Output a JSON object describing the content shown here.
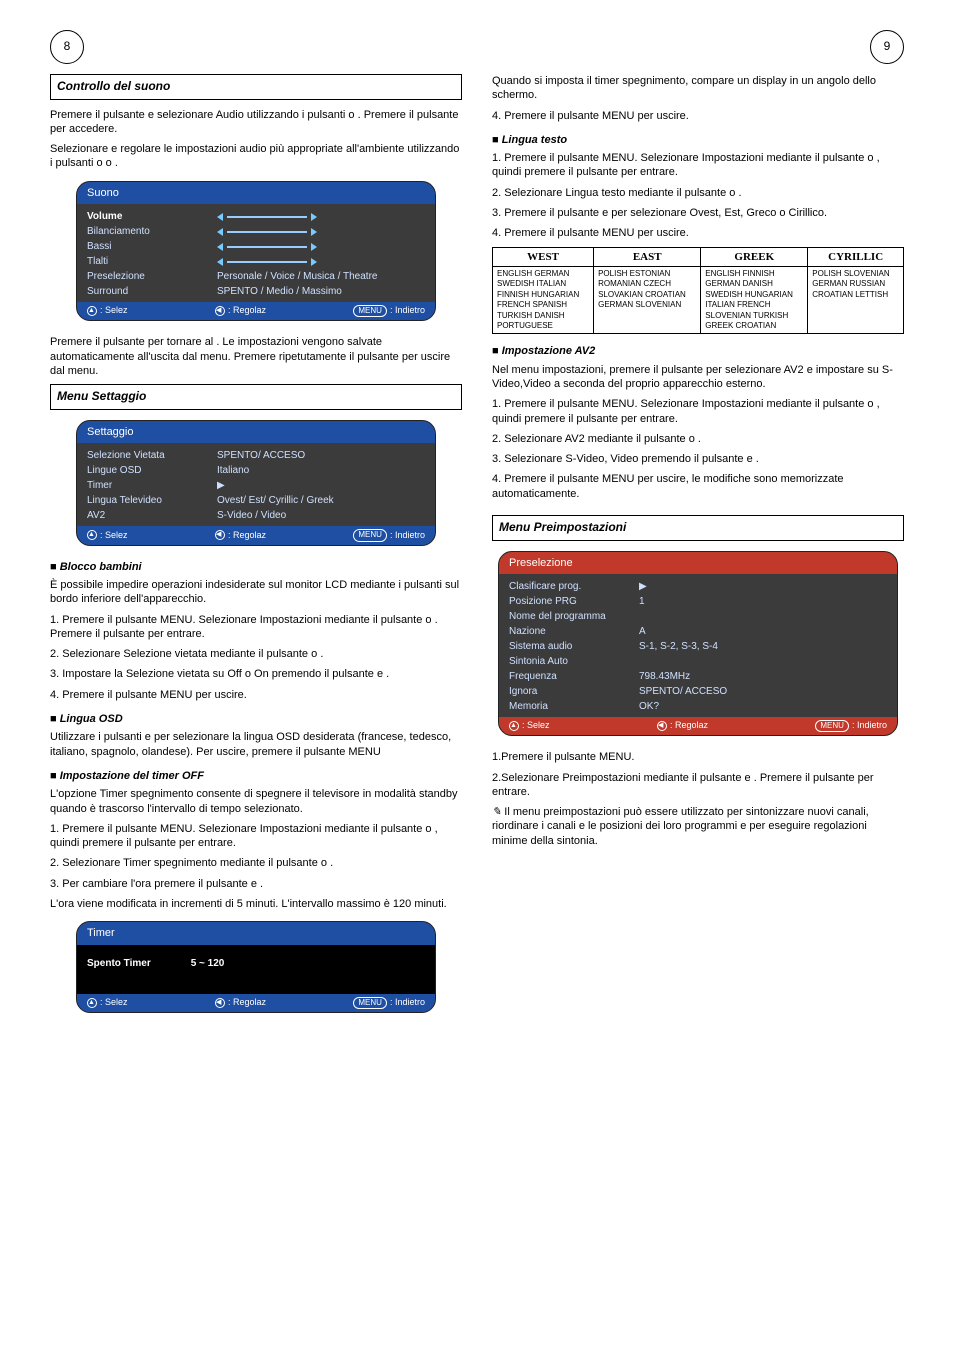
{
  "page": {
    "left_no": "8",
    "right_no": "9"
  },
  "leftcol": {
    "section1_title": "Controllo del suono",
    "p1a": "Premere il pulsante ",
    "p1b": " e selezionare Audio utilizzando i pulsanti ",
    "p1c": " o ",
    "p1d": ". Premere il pulsante ",
    "p1e": " per accedere.",
    "p2": "Selezionare e regolare le impostazioni audio più appropriate all'ambiente utilizzando i pulsanti ",
    "p2b": " o ",
    "p2c": " o ",
    "p2d": ".",
    "osd1": {
      "title": "Suono",
      "rows": [
        {
          "label": "Volume",
          "slider": true
        },
        {
          "label": "Bilanciamento",
          "slider": true
        },
        {
          "label": "Bassi",
          "slider": true
        },
        {
          "label": "Tlalti",
          "slider": true
        },
        {
          "label": "Preselezione",
          "value": "Personale / Voice / Musica / Theatre"
        },
        {
          "label": "Surround",
          "value": "SPENTO / Medio / Massimo"
        }
      ],
      "footer": {
        "sel": ": Selez",
        "reg": ": Regolaz",
        "back": ": Indietro",
        "menu": "MENU"
      }
    },
    "p3a": "Premere il pulsante ",
    "p3b": " per tornare al ",
    "p3c": ". Le impostazioni vengono salvate automaticamente all'uscita dal menu. Premere ripetutamente il pulsante ",
    "p3d": " per uscire dal menu.",
    "section2_title": "Menu Settaggio",
    "osd2": {
      "title": "Settaggio",
      "rows": [
        {
          "label": "Selezione Vietata",
          "value": "SPENTO/ ACCESO"
        },
        {
          "label": "Lingue OSD",
          "value": "Italiano"
        },
        {
          "label": "Timer",
          "value": "▶"
        },
        {
          "label": "Lingua Televideo",
          "value": "Ovest/ Est/ Cyrillic / Greek"
        },
        {
          "label": "AV2",
          "value": "S-Video / Video"
        }
      ],
      "footer": {
        "sel": ": Selez",
        "reg": ": Regolaz",
        "back": ": Indietro",
        "menu": "MENU"
      }
    },
    "h_childlock": "Blocco bambini",
    "cl_p1": "È possibile impedire operazioni indesiderate sul monitor LCD mediante i pulsanti sul bordo inferiore dell'apparecchio.",
    "cl_p2a": "1. Premere il pulsante MENU. Selezionare Impostazioni mediante il pulsante ",
    "cl_p2b": " o ",
    "cl_p2c": ". Premere il pulsante ",
    "cl_p2d": " per entrare.",
    "cl_p3a": "2. Selezionare Selezione vietata mediante il pulsante ",
    "cl_p3b": " o ",
    "cl_p3c": ".",
    "cl_p4a": "3. Impostare la Selezione vietata su Off o On premendo il pulsante ",
    "cl_p4b": " e ",
    "cl_p4c": ".",
    "cl_p5": "4. Premere il pulsante MENU per uscire.",
    "h_osdlang": "Lingua OSD",
    "osdl_p1a": "Utilizzare i pulsanti ",
    "osdl_p1b": " e ",
    "osdl_p1c": " per selezionare la lingua OSD desiderata (francese, tedesco, italiano, spagnolo, olandese). Per uscire, premere il pulsante MENU",
    "h_sleep": "Impostazione del timer OFF",
    "sl_p1": "L'opzione Timer spegnimento consente di spegnere il televisore in modalità standby quando è trascorso l'intervallo di tempo selezionato.",
    "sl_p2a": "1. Premere il pulsante MENU. Selezionare Impostazioni mediante il pulsante ",
    "sl_p2b": " o ",
    "sl_p2c": ", quindi premere il pulsante ",
    "sl_p2d": " per entrare.",
    "sl_p3a": "2. Selezionare Timer spegnimento mediante il pulsante ",
    "sl_p3b": " o ",
    "sl_p3c": ".",
    "sl_p4a": "3. Per cambiare l'ora premere il pulsante ",
    "sl_p4b": " e ",
    "sl_p4c": ".",
    "sl_p5": "L'ora viene modificata in incrementi di 5 minuti. L'intervallo massimo è 120 minuti.",
    "osd3": {
      "title": "Timer",
      "row_label": "Spento Timer",
      "row_value": "5 ~ 120",
      "footer": {
        "sel": ": Selez",
        "reg": ": Regolaz",
        "back": ": Indietro",
        "menu": "MENU"
      }
    }
  },
  "rightcol": {
    "top_p1": "Quando si imposta il timer spegnimento, compare un display in un angolo dello schermo.",
    "top_p2": "4. Premere il pulsante MENU per uscire.",
    "h_txtlang": "Lingua testo",
    "tx_p1a": "1. Premere il pulsante MENU. Selezionare Impostazioni mediante il pulsante ",
    "tx_p1b": " o ",
    "tx_p1c": ", quindi premere il pulsante ",
    "tx_p1d": " per entrare.",
    "tx_p2a": "2. Selezionare Lingua testo mediante il pulsante ",
    "tx_p2b": " o ",
    "tx_p2c": ".",
    "tx_p3a": "3. Premere il pulsante ",
    "tx_p3b": " e ",
    "tx_p3c": " per selezionare Ovest, Est, Greco o Cirillico.",
    "tx_p4": "4. Premere il pulsante MENU per uscire.",
    "langtable": {
      "headers": [
        "WEST",
        "EAST",
        "GREEK",
        "CYRILLIC"
      ],
      "cols": [
        "ENGLISH  GERMAN\nSWEDISH  ITALIAN\nFINNISH  HUNGARIAN\nFRENCH  SPANISH\nTURKISH  DANISH\nPORTUGUESE",
        "POLISH  ESTONIAN\nROMANIAN  CZECH\nSLOVAKIAN  CROATIAN\nGERMAN  SLOVENIAN",
        "ENGLISH  FINNISH\nGERMAN  DANISH\nSWEDISH  HUNGARIAN\nITALIAN  FRENCH\nSLOVENIAN  TURKISH\nGREEK  CROATIAN",
        "POLISH  SLOVENIAN\nGERMAN  RUSSIAN\nCROATIAN  LETTISH"
      ]
    },
    "h_av2": "Impostazione AV2",
    "av_p1a": "Nel menu impostazioni, premere il pulsante ",
    "av_p1b": " per selezionare AV2 e impostare su  S-Video,Video a seconda del proprio apparecchio esterno.",
    "av_p2a": "1. Premere il pulsante MENU. Selezionare Impostazioni mediante il pulsante ",
    "av_p2b": " o ",
    "av_p2c": ", quindi premere il pulsante ",
    "av_p2d": " per entrare.",
    "av_p3a": "2. Selezionare AV2 mediante il pulsante ",
    "av_p3b": " o ",
    "av_p3c": ".",
    "av_p4a": "3. Selezionare  S-Video, Video premendo il pulsante ",
    "av_p4b": " e ",
    "av_p4c": ".",
    "av_p5": "4. Premere il pulsante MENU per uscire, le modifiche sono memorizzate automaticamente.",
    "section_preset_title": "Menu Preimpostazioni",
    "osd4": {
      "title": "Preselezione",
      "rows": [
        {
          "label": "Clasificare prog.",
          "value": "▶"
        },
        {
          "label": "Posizione PRG",
          "value": "1"
        },
        {
          "label": "Nome del programma",
          "value": ""
        },
        {
          "label": "Nazione",
          "value": "A"
        },
        {
          "label": "Sistema audio",
          "value": "S-1, S-2, S-3, S-4"
        },
        {
          "label": "Sintonia Auto",
          "value": ""
        },
        {
          "label": "Frequenza",
          "value": "798.43MHz"
        },
        {
          "label": "Ignora",
          "value": "SPENTO/ ACCESO"
        },
        {
          "label": "Memoria",
          "value": "OK?"
        }
      ],
      "footer": {
        "sel": ": Selez",
        "reg": ": Regolaz",
        "back": ": Indietro",
        "menu": "MENU"
      }
    },
    "pr_p1": "1.Premere il pulsante MENU.",
    "pr_p2a": "2.Selezionare Preimpostazioni mediante il pulsante ",
    "pr_p2b": " e ",
    "pr_p2c": ". Premere il pulsante ",
    "pr_p2d": " per entrare.",
    "pr_note": " Il menu preimpostazioni può essere utilizzato per sintonizzare nuovi canali, riordinare i canali e le posizioni dei loro programmi e per eseguire regolazioni minime della sintonia."
  }
}
